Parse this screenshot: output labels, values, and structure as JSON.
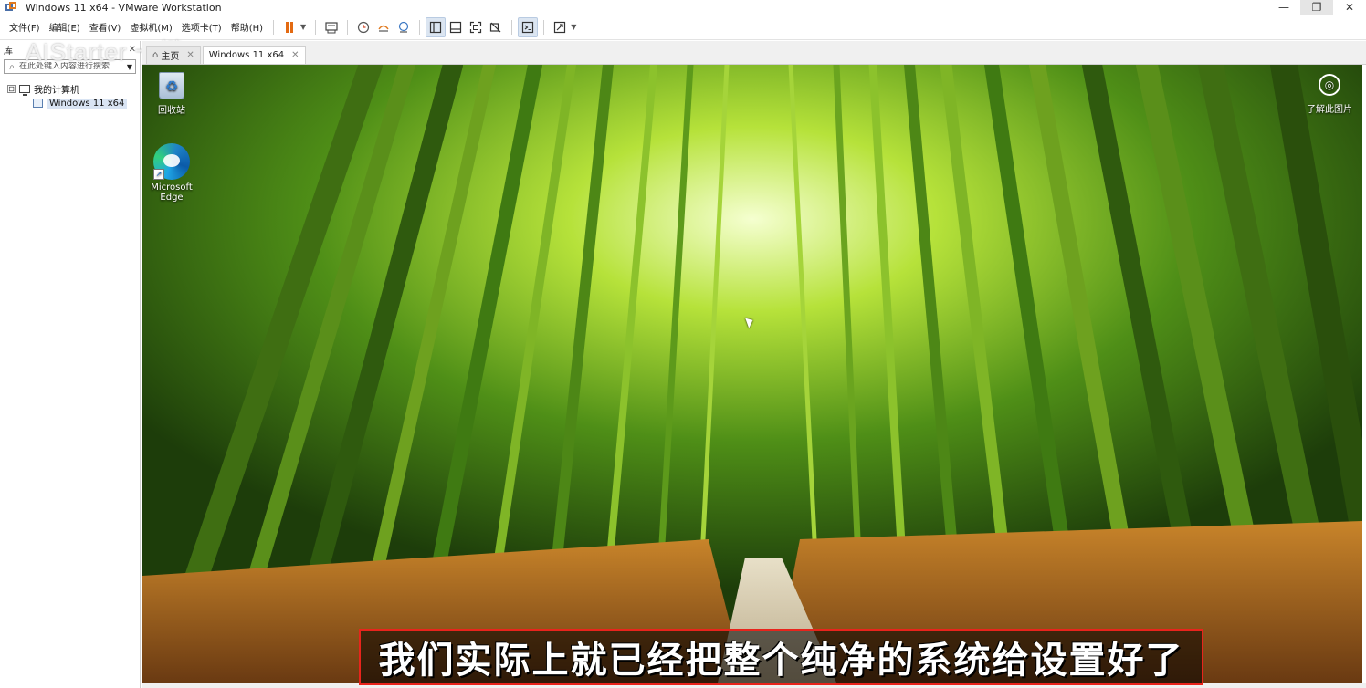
{
  "window": {
    "title": "Windows 11 x64 - VMware Workstation",
    "minimize": "—",
    "restore": "❐",
    "close": "✕"
  },
  "menu": {
    "items": [
      "文件(F)",
      "编辑(E)",
      "查看(V)",
      "虚拟机(M)",
      "选项卡(T)",
      "帮助(H)"
    ]
  },
  "library": {
    "title": "库",
    "close": "✕",
    "watermark": "AIStarter 一键…",
    "search_placeholder": "在此处键入内容进行搜索",
    "tree": {
      "root_expander": "⊟",
      "root_label": "我的计算机",
      "vm_label": "Windows 11 x64"
    }
  },
  "tabs": [
    {
      "label": "主页"
    },
    {
      "label": "Windows 11 x64"
    }
  ],
  "desktop": {
    "icons": [
      {
        "label": "回收站"
      },
      {
        "label": "Microsoft Edge"
      }
    ],
    "learn_more": "了解此图片"
  },
  "caption": {
    "text": "我们实际上就已经把整个纯净的系统给设置好了"
  },
  "colors": {
    "caption_border": "#e8241c",
    "pause_orange": "#e36a12",
    "selection_blue": "#d9e4f3"
  }
}
